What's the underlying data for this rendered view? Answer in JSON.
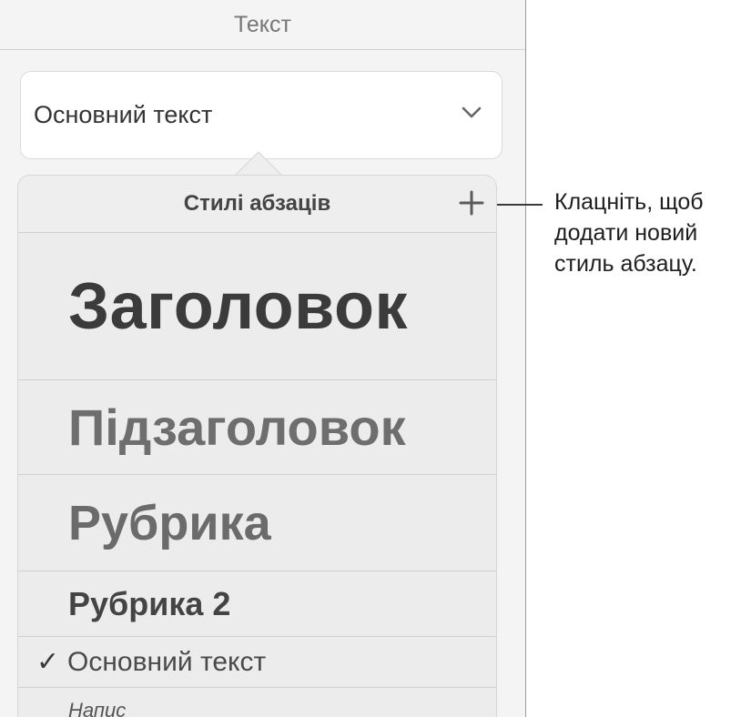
{
  "panel": {
    "title": "Текст"
  },
  "selector": {
    "current_style": "Основний текст",
    "chevron_icon": "chevron-down-icon"
  },
  "popover": {
    "title": "Стилі абзаців",
    "add_icon": "plus-icon",
    "styles": [
      {
        "label": "Заголовок"
      },
      {
        "label": "Підзаголовок"
      },
      {
        "label": "Рубрика"
      },
      {
        "label": "Рубрика 2"
      },
      {
        "label": "Основний текст",
        "selected": true
      },
      {
        "label": "Напис"
      }
    ],
    "check_glyph": "✓"
  },
  "callout": {
    "lines": [
      "Клацніть, щоб",
      "додати новий",
      "стиль абзацу."
    ]
  }
}
